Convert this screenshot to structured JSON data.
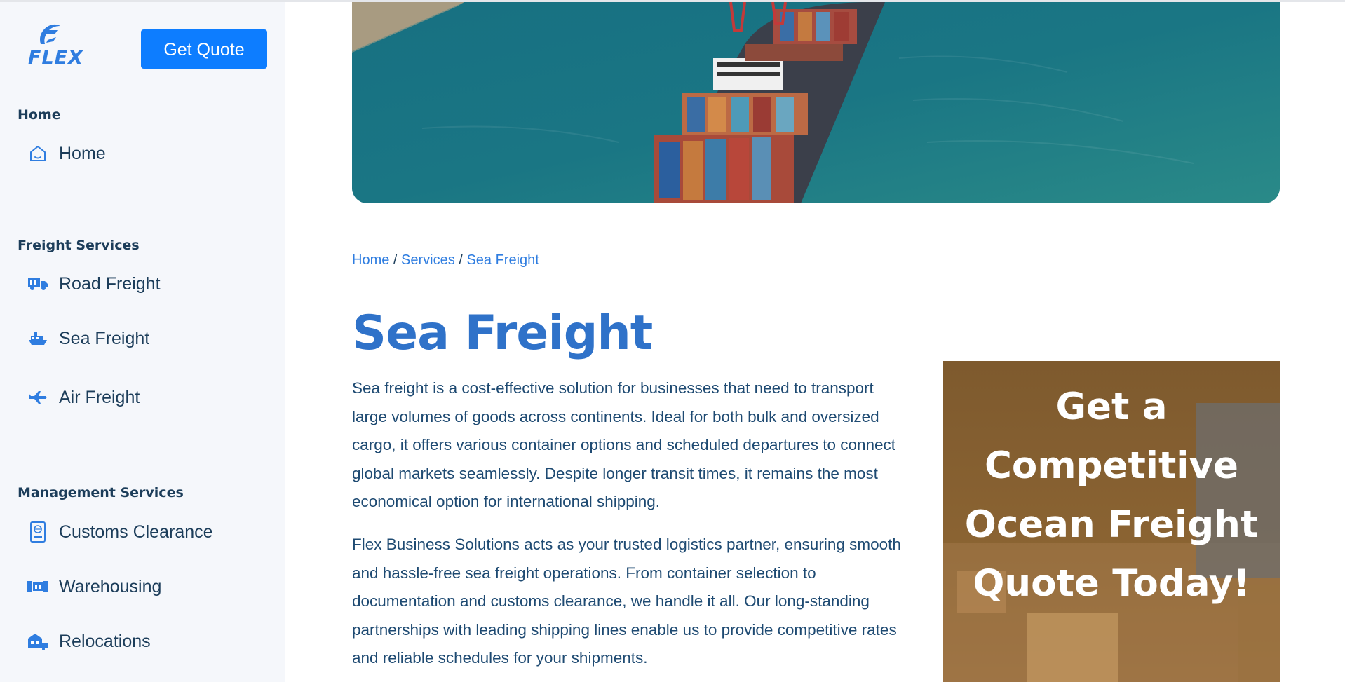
{
  "brand": {
    "logo_text": "FLEX"
  },
  "header": {
    "quote_button": "Get Quote"
  },
  "sidebar": {
    "sections": [
      {
        "title": "Home",
        "items": [
          {
            "label": "Home",
            "icon": "home-icon"
          }
        ]
      },
      {
        "title": "Freight Services",
        "items": [
          {
            "label": "Road Freight",
            "icon": "truck-icon"
          },
          {
            "label": "Sea Freight",
            "icon": "ship-icon"
          },
          {
            "label": "Air Freight",
            "icon": "plane-icon"
          }
        ]
      },
      {
        "title": "Management Services",
        "items": [
          {
            "label": "Customs Clearance",
            "icon": "passport-icon"
          },
          {
            "label": "Warehousing",
            "icon": "warehouse-icon"
          },
          {
            "label": "Relocations",
            "icon": "relocation-icon"
          }
        ]
      }
    ]
  },
  "breadcrumb": {
    "home": "Home",
    "sep": "/",
    "services": "Services",
    "current": "Sea Freight"
  },
  "main": {
    "title": "Sea Freight",
    "paragraphs": [
      "Sea freight is a cost-effective solution for businesses that need to transport large volumes of goods across continents. Ideal for both bulk and oversized cargo, it offers various container options and scheduled departures to connect global markets seamlessly. Despite longer transit times, it remains the most economical option for international shipping.",
      "Flex Business Solutions acts as your trusted logistics partner, ensuring smooth and hassle-free sea freight operations. From container selection to documentation and customs clearance, we handle it all. Our long-standing partnerships with leading shipping lines enable us to provide competitive rates and reliable schedules for your shipments."
    ]
  },
  "promo": {
    "text": "Get a Competitive Ocean Freight Quote Today!"
  },
  "colors": {
    "accent": "#0d7dff",
    "title_blue": "#2f72c9",
    "text_navy": "#1e4a72",
    "sidebar_bg": "#f5f7fb"
  }
}
